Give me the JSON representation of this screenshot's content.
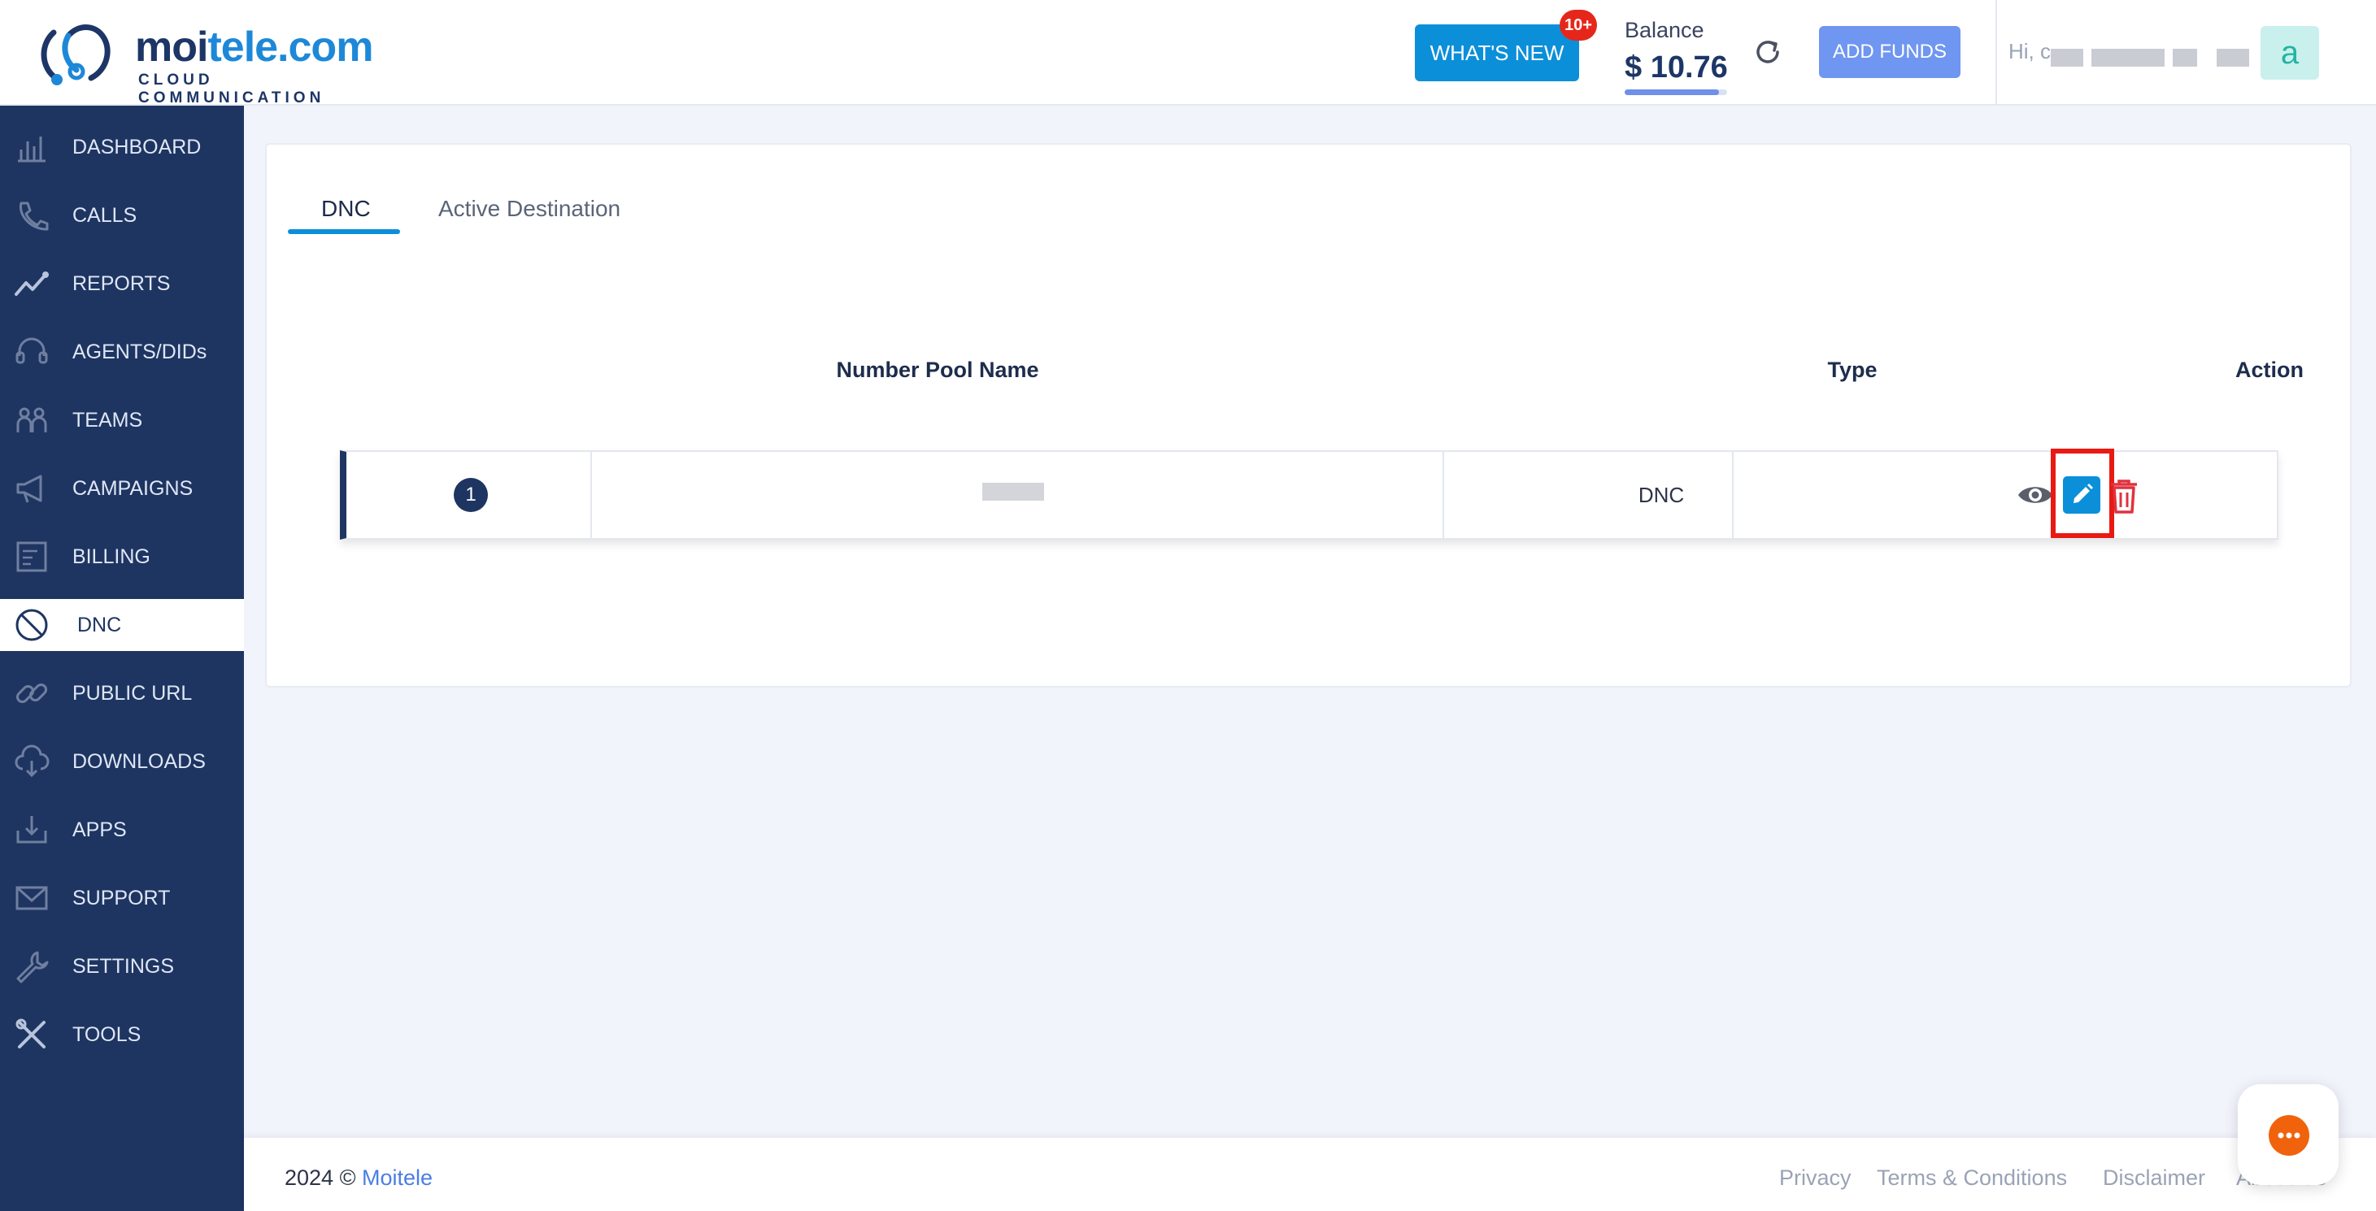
{
  "brand": {
    "name_part1": "moi",
    "name_part2": "tele.com",
    "tagline": "CLOUD COMMUNICATION"
  },
  "header": {
    "whats_new_label": "WHAT'S NEW",
    "whats_new_badge": "10+",
    "balance_label": "Balance",
    "balance_value": "$ 10.76",
    "balance_progress": 0.92,
    "add_funds_label": "ADD FUNDS",
    "greeting": "Hi, c",
    "avatar_letter": "a"
  },
  "sidebar": {
    "items": [
      {
        "label": "DASHBOARD",
        "icon": "dashboard-icon"
      },
      {
        "label": "CALLS",
        "icon": "phone-icon"
      },
      {
        "label": "REPORTS",
        "icon": "trend-chart-icon"
      },
      {
        "label": "AGENTS/DIDs",
        "icon": "headset-icon"
      },
      {
        "label": "TEAMS",
        "icon": "team-icon"
      },
      {
        "label": "CAMPAIGNS",
        "icon": "megaphone-icon"
      },
      {
        "label": "BILLING",
        "icon": "invoice-icon"
      },
      {
        "label": "DNC",
        "icon": "prohibited-icon"
      },
      {
        "label": "PUBLIC URL",
        "icon": "link-icon"
      },
      {
        "label": "DOWNLOADS",
        "icon": "cloud-download-icon"
      },
      {
        "label": "APPS",
        "icon": "app-install-icon"
      },
      {
        "label": "SUPPORT",
        "icon": "mail-icon"
      },
      {
        "label": "SETTINGS",
        "icon": "wrench-icon"
      },
      {
        "label": "TOOLS",
        "icon": "tools-icon"
      }
    ],
    "active": "DNC"
  },
  "tabs": [
    {
      "label": "DNC"
    },
    {
      "label": "Active Destination"
    }
  ],
  "table": {
    "columns": [
      "Number Pool Name",
      "Type",
      "Action"
    ],
    "rows": [
      {
        "index": "1",
        "type": "DNC"
      }
    ]
  },
  "footer": {
    "year": "2024 © ",
    "brand": "Moitele",
    "links": [
      "Privacy",
      "Terms & Conditions",
      "Disclaimer",
      "About Us"
    ]
  },
  "colors": {
    "sidebar": "#1e3561",
    "primary": "#0c8fd9",
    "highlight": "#e81a12",
    "delete": "#e0323f"
  }
}
